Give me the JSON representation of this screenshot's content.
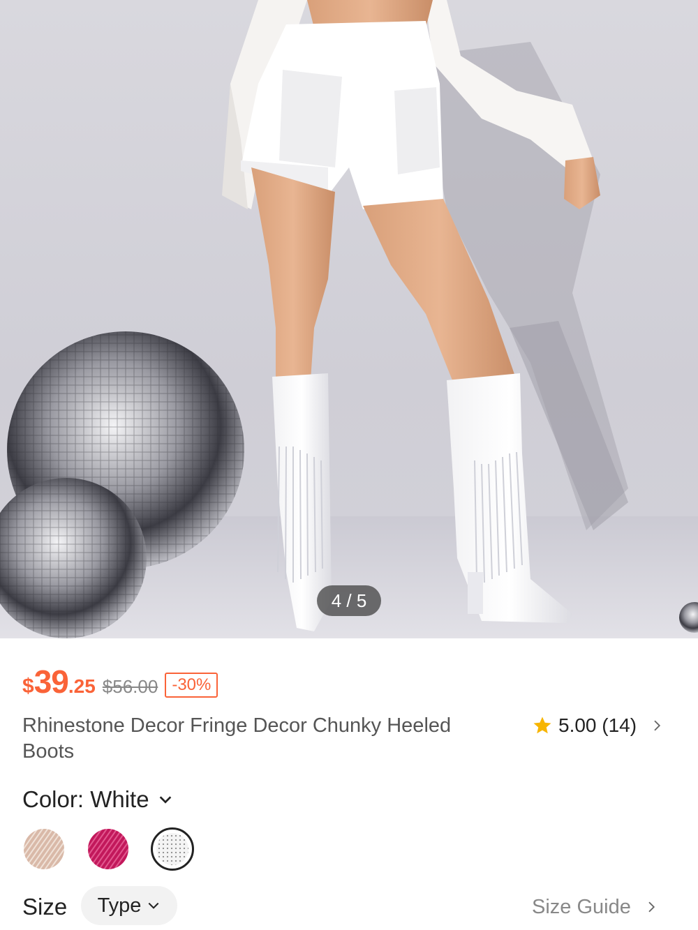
{
  "gallery": {
    "page_indicator": "4 / 5",
    "current_index": 4,
    "total": 5
  },
  "price": {
    "currency": "$",
    "integer": "39",
    "decimal": ".25",
    "original": "$56.00",
    "discount": "-30%",
    "accent_color": "#fa6338"
  },
  "product": {
    "title": "Rhinestone Decor Fringe Decor Chunky Heeled Boots"
  },
  "rating": {
    "score_text": "5.00 (14)",
    "star_icon": "star-icon",
    "star_color": "#f7b500"
  },
  "color": {
    "label": "Color: White",
    "swatches": [
      {
        "name": "champagne",
        "color": "#d9b9a8"
      },
      {
        "name": "fuchsia",
        "color": "#c2185b"
      },
      {
        "name": "white",
        "color": "#f4f4f4",
        "selected": true
      }
    ]
  },
  "size": {
    "label": "Size",
    "type_label": "Type",
    "guide_label": "Size Guide"
  }
}
